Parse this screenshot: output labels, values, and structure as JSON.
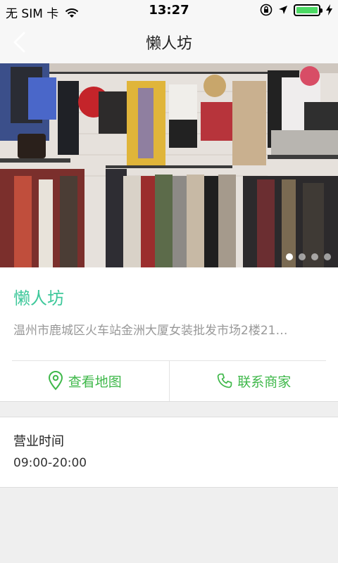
{
  "status_bar": {
    "carrier": "无 SIM 卡",
    "time": "13:27",
    "icons": [
      "wifi-icon",
      "rotation-lock-icon",
      "location-icon",
      "battery-icon",
      "charging-icon"
    ]
  },
  "nav": {
    "title": "懒人坊",
    "back_icon": "chevron-left-icon"
  },
  "banner": {
    "image": "clothing store interior photo",
    "slide_count": 4,
    "active_slide": 1
  },
  "shop": {
    "name": "懒人坊",
    "address": "温州市鹿城区火车站金洲大厦女装批发市场2楼21…"
  },
  "actions": {
    "map_label": "查看地图",
    "map_icon": "location-pin-icon",
    "contact_label": "联系商家",
    "contact_icon": "phone-icon"
  },
  "hours": {
    "label": "营业时间",
    "value": "09:00-20:00"
  },
  "colors": {
    "accent_teal": "#3fc89b",
    "accent_green": "#3fb84a",
    "battery_green": "#4cd964",
    "background": "#efefef"
  }
}
